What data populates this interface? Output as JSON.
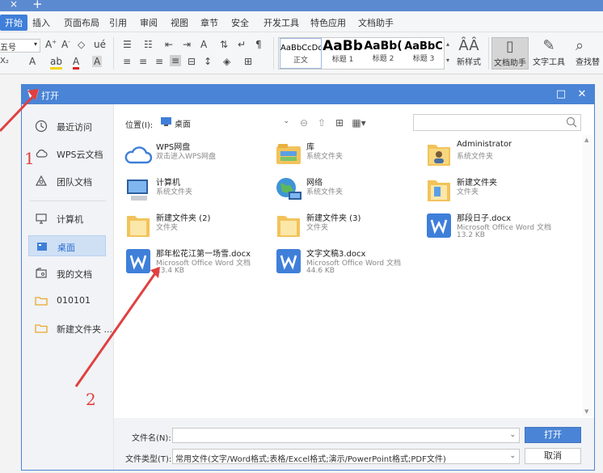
{
  "tabstrip": {
    "close_glyph": "×",
    "plus_glyph": "+"
  },
  "menu": {
    "items": [
      {
        "label": "开始",
        "active": true
      },
      {
        "label": "插入"
      },
      {
        "label": "页面布局"
      },
      {
        "label": "引用"
      },
      {
        "label": "审阅"
      },
      {
        "label": "视图"
      },
      {
        "label": "章节"
      },
      {
        "label": "安全"
      },
      {
        "label": "开发工具"
      },
      {
        "label": "特色应用"
      },
      {
        "label": "文档助手"
      }
    ]
  },
  "toolbar": {
    "font_size_value": "五号",
    "styles": [
      {
        "sample": "AaBbCcDd",
        "name": "正文"
      },
      {
        "sample": "AaBb",
        "name": "标题 1"
      },
      {
        "sample": "AaBb(",
        "name": "标题 2"
      },
      {
        "sample": "AaBbC",
        "name": "标题 3"
      }
    ],
    "new_style_label": "新样式",
    "doc_assistant_label": "文档助手",
    "text_tools_label": "文字工具",
    "find_label": "查找替"
  },
  "dialog": {
    "title": "打开",
    "sidebar": [
      {
        "label": "最近访问",
        "icon": "clock-icon"
      },
      {
        "label": "WPS云文档",
        "icon": "cloud-icon"
      },
      {
        "label": "团队文档",
        "icon": "team-icon"
      },
      {
        "label": "计算机",
        "icon": "computer-icon"
      },
      {
        "label": "桌面",
        "icon": "desktop-icon",
        "active": true
      },
      {
        "label": "我的文档",
        "icon": "my-documents-icon"
      },
      {
        "label": "010101",
        "icon": "folder-icon"
      },
      {
        "label": "新建文件夹 ...",
        "icon": "folder-icon"
      }
    ],
    "location_label": "位置(I):",
    "location_value": "桌面",
    "files": [
      {
        "name": "WPS网盘",
        "sub": "双击进入WPS网盘",
        "size": "",
        "icon": "wps-cloud-icon"
      },
      {
        "name": "库",
        "sub": "系统文件夹",
        "size": "",
        "icon": "library-icon"
      },
      {
        "name": "Administrator",
        "sub": "系统文件夹",
        "size": "",
        "icon": "user-folder-icon"
      },
      {
        "name": "计算机",
        "sub": "系统文件夹",
        "size": "",
        "icon": "computer-icon"
      },
      {
        "name": "网络",
        "sub": "系统文件夹",
        "size": "",
        "icon": "network-icon"
      },
      {
        "name": "新建文件夹",
        "sub": "文件夹",
        "size": "",
        "icon": "folder-icon"
      },
      {
        "name": "新建文件夹 (2)",
        "sub": "文件夹",
        "size": "",
        "icon": "folder-icon"
      },
      {
        "name": "新建文件夹 (3)",
        "sub": "文件夹",
        "size": "",
        "icon": "folder-icon"
      },
      {
        "name": "那段日子.docx",
        "sub": "Microsoft Office Word 文档",
        "size": "13.2 KB",
        "icon": "wps-doc-icon"
      },
      {
        "name": "那年松花江第一场雪.docx",
        "sub": "Microsoft Office Word 文档",
        "size": "13.4 KB",
        "icon": "wps-doc-icon"
      },
      {
        "name": "文字文稿3.docx",
        "sub": "Microsoft Office Word 文档",
        "size": "44.6 KB",
        "icon": "wps-doc-icon"
      }
    ],
    "filename_label": "文件名(N):",
    "filename_value": "",
    "filetype_label": "文件类型(T):",
    "filetype_value": "常用文件(文字/Word格式;表格/Excel格式;演示/PowerPoint格式;PDF文件)",
    "open_button": "打开",
    "cancel_button": "取消"
  },
  "annotations": {
    "num1": "1",
    "num2": "2"
  },
  "colors": {
    "accent": "#4a84d6",
    "annotation": "#e04040",
    "folder": "#f2c35b",
    "wps_blue": "#3f7fd9"
  }
}
